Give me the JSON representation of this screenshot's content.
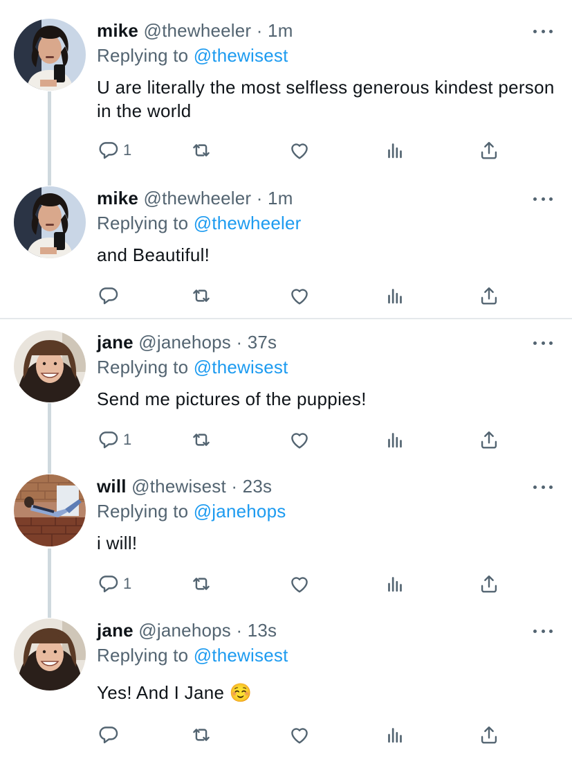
{
  "colors": {
    "accent": "#1d9bf0",
    "muted": "#536471",
    "text": "#0f1419",
    "divider": "#e4e8eb",
    "thread_line": "#cfd9de"
  },
  "tweets": [
    {
      "name": "mike",
      "handle": "@thewheeler",
      "dot": "·",
      "time": "1m",
      "reply_prefix": "Replying to",
      "reply_to": "@thewisest",
      "text": "U are literally the most selfless generous kindest person in the world",
      "reply_count": "1",
      "avatar_icon": "mike-avatar"
    },
    {
      "name": "mike",
      "handle": "@thewheeler",
      "dot": "·",
      "time": "1m",
      "reply_prefix": "Replying to",
      "reply_to": "@thewheeler",
      "text": "and Beautiful!",
      "reply_count": "",
      "avatar_icon": "mike-avatar"
    },
    {
      "name": "jane",
      "handle": "@janehops",
      "dot": "·",
      "time": "37s",
      "reply_prefix": "Replying to",
      "reply_to": "@thewisest",
      "text": "Send me pictures of the puppies!",
      "reply_count": "1",
      "avatar_icon": "jane-avatar"
    },
    {
      "name": "will",
      "handle": "@thewisest",
      "dot": "·",
      "time": "23s",
      "reply_prefix": "Replying to",
      "reply_to": "@janehops",
      "text": "i will!",
      "reply_count": "1",
      "avatar_icon": "will-avatar"
    },
    {
      "name": "jane",
      "handle": "@janehops",
      "dot": "·",
      "time": "13s",
      "reply_prefix": "Replying to",
      "reply_to": "@thewisest",
      "text": "Yes! And I Jane ☺️",
      "reply_count": "",
      "avatar_icon": "jane-avatar"
    }
  ]
}
